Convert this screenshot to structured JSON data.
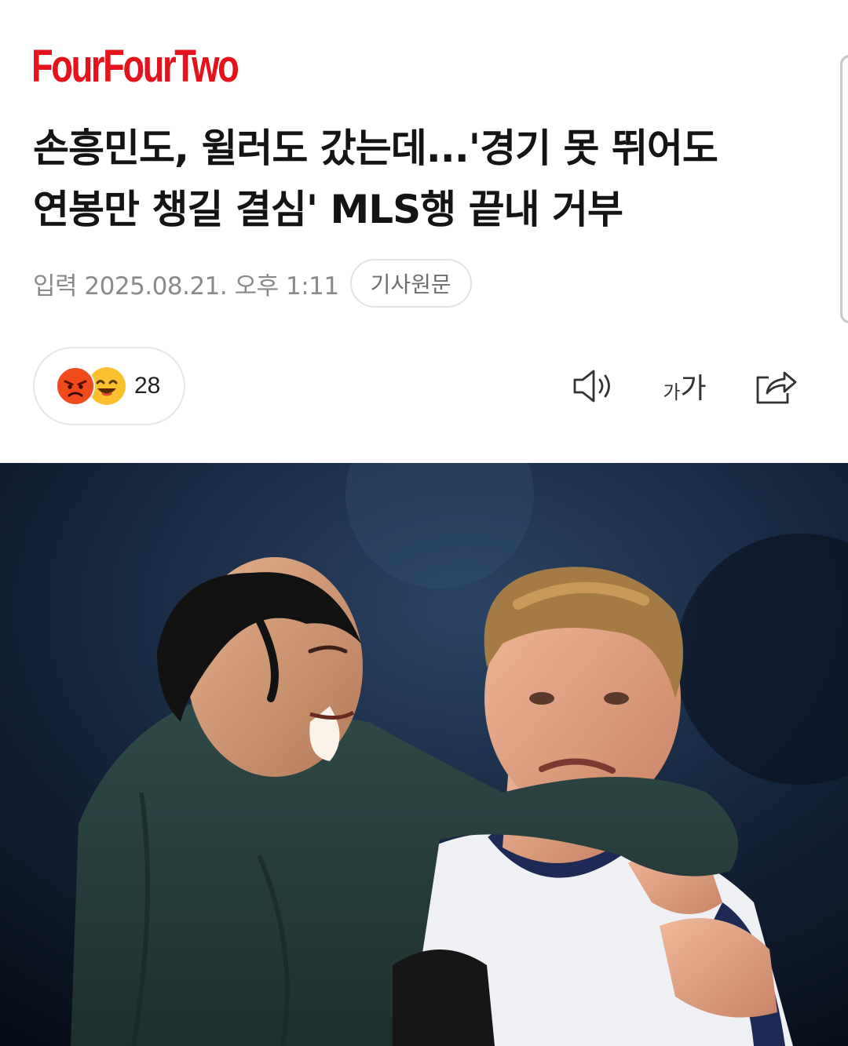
{
  "brand": {
    "logo_text": "FourFourTwo",
    "logo_color": "#e3121b"
  },
  "article": {
    "headline_line1": "손흥민도, 윌러도 갔는데...'경기 못 뛰어도",
    "headline_line2": "연봉만 챙길 결심' MLS행 끝내 거부",
    "published_label": "입력 2025.08.21. 오후 1:11",
    "original_article_button": "기사원문"
  },
  "reactions": {
    "icons": [
      "angry-face-icon",
      "happy-face-icon"
    ],
    "count": "28"
  },
  "toolbar": {
    "tts_icon": "speaker-icon",
    "font_size_small": "가",
    "font_size_large": "가",
    "share_icon": "share-icon"
  },
  "photo": {
    "description_icon": "article-photo"
  },
  "colors": {
    "headline": "#141414",
    "meta": "#8a8a8a",
    "border": "#e6e6e6"
  }
}
